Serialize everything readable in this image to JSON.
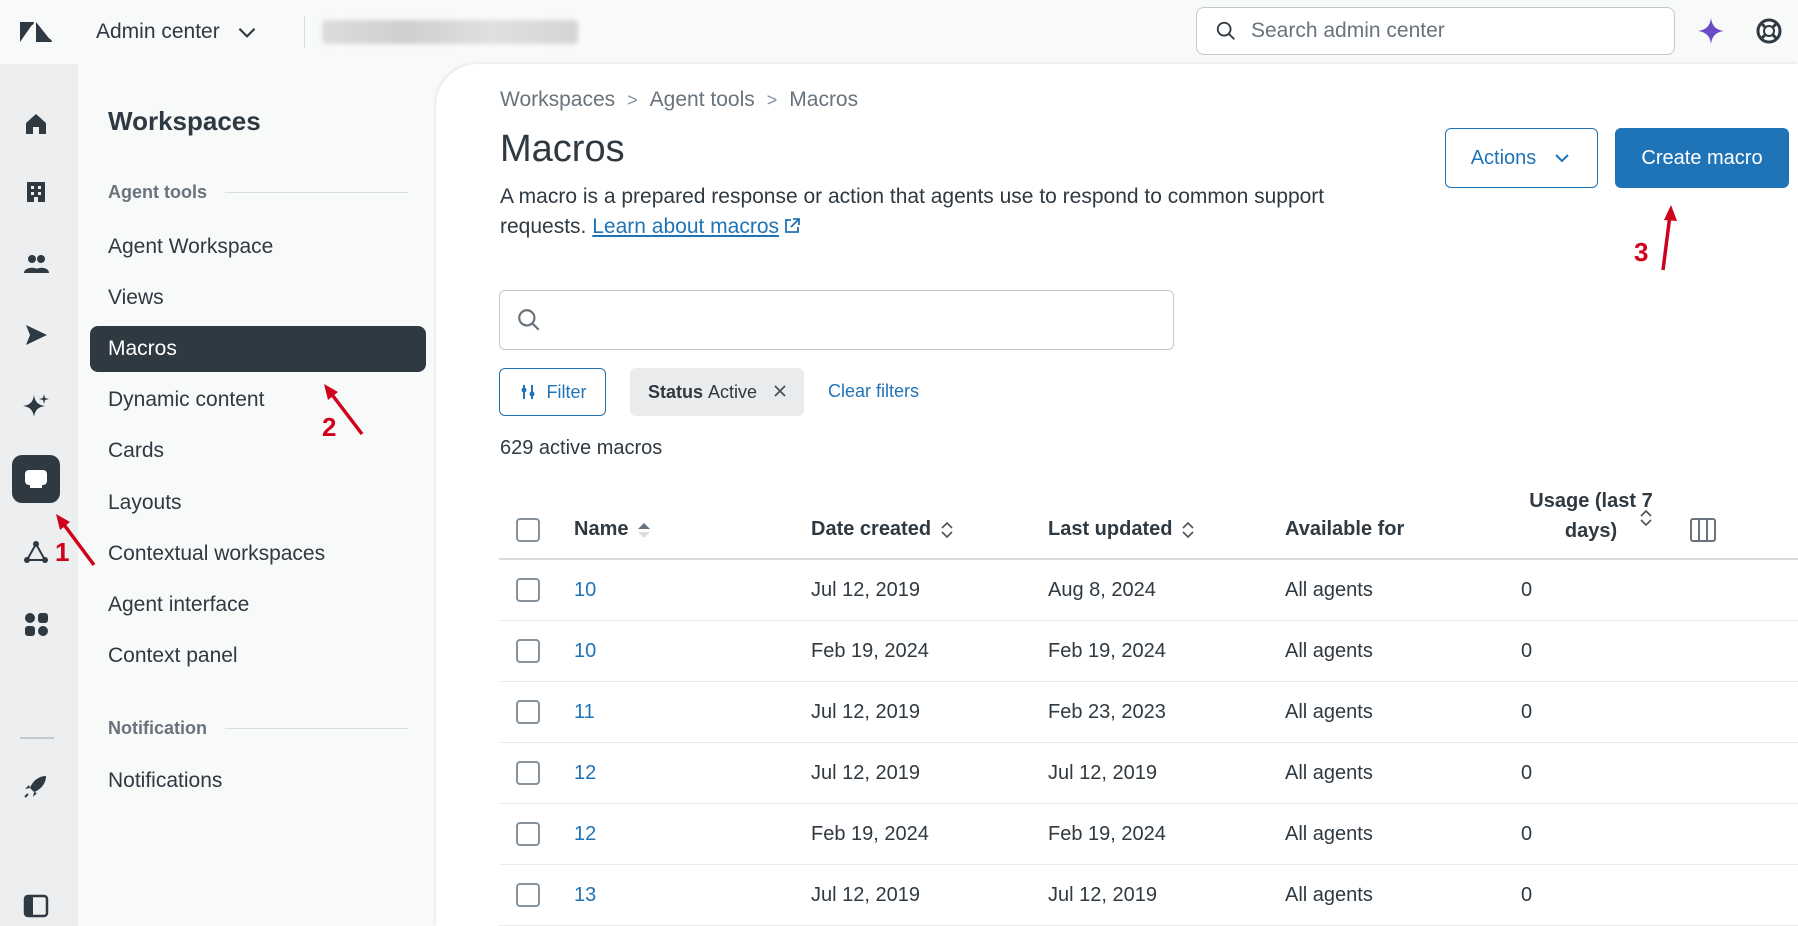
{
  "topbar": {
    "product_label": "Admin center",
    "search_placeholder": "Search admin center"
  },
  "rail": {
    "icons": [
      "home-icon",
      "building-icon",
      "people-icon",
      "send-icon",
      "sparkle-icon",
      "workspace-icon",
      "objects-icon",
      "apps-icon",
      "rocket-icon",
      "sidebar-toggle-icon"
    ]
  },
  "subnav": {
    "title": "Workspaces",
    "section_agent_tools": "Agent tools",
    "items": [
      "Agent Workspace",
      "Views",
      "Macros",
      "Dynamic content",
      "Cards",
      "Layouts",
      "Contextual workspaces",
      "Agent interface",
      "Context panel"
    ],
    "section_notification": "Notification",
    "notification_items": [
      "Notifications"
    ]
  },
  "breadcrumb": {
    "items": [
      "Workspaces",
      "Agent tools",
      "Macros"
    ],
    "separator": ">"
  },
  "page": {
    "title": "Macros",
    "description": "A macro is a prepared response or action that agents use to respond to common support requests.",
    "learn_link": "Learn about macros",
    "actions_label": "Actions",
    "create_label": "Create macro",
    "filter_label": "Filter",
    "chip_key": "Status",
    "chip_value": "Active",
    "clear_filters": "Clear filters",
    "count_text": "629 active macros"
  },
  "table": {
    "columns": [
      "Name",
      "Date created",
      "Last updated",
      "Available for",
      "Usage (last 7 days)"
    ],
    "rows": [
      {
        "name": "10",
        "created": "Jul 12, 2019",
        "updated": "Aug 8, 2024",
        "available": "All agents",
        "usage": "0"
      },
      {
        "name": "10",
        "created": "Feb 19, 2024",
        "updated": "Feb 19, 2024",
        "available": "All agents",
        "usage": "0"
      },
      {
        "name": "11",
        "created": "Jul 12, 2019",
        "updated": "Feb 23, 2023",
        "available": "All agents",
        "usage": "0"
      },
      {
        "name": "12",
        "created": "Jul 12, 2019",
        "updated": "Jul 12, 2019",
        "available": "All agents",
        "usage": "0"
      },
      {
        "name": "12",
        "created": "Feb 19, 2024",
        "updated": "Feb 19, 2024",
        "available": "All agents",
        "usage": "0"
      },
      {
        "name": "13",
        "created": "Jul 12, 2019",
        "updated": "Jul 12, 2019",
        "available": "All agents",
        "usage": "0"
      }
    ]
  },
  "annotations": [
    "1",
    "2",
    "3"
  ],
  "colors": {
    "accent": "#1f73b7",
    "active_nav": "#2f3941",
    "annotation": "#d0021b"
  }
}
